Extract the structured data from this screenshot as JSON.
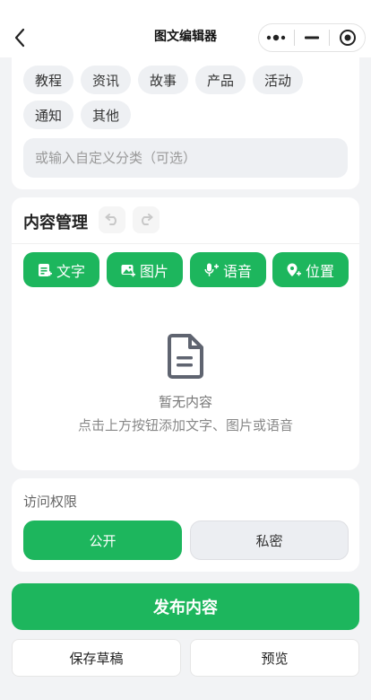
{
  "nav": {
    "title": "图文编辑器",
    "back_icon": "chevron-left-icon",
    "more_icon": "more-dots-icon",
    "minimize_icon": "minimize-icon",
    "close_icon": "target-circle-icon"
  },
  "categories": {
    "chips": [
      "教程",
      "资讯",
      "故事",
      "产品",
      "活动",
      "通知",
      "其他"
    ],
    "custom_placeholder": "或输入自定义分类（可选）"
  },
  "content": {
    "title": "内容管理",
    "undo_icon": "undo-icon",
    "redo_icon": "redo-icon",
    "add_buttons": [
      {
        "label": "文字",
        "icon": "text-doc-icon"
      },
      {
        "label": "图片",
        "icon": "image-add-icon"
      },
      {
        "label": "语音",
        "icon": "mic-icon"
      },
      {
        "label": "位置",
        "icon": "location-pin-icon"
      }
    ],
    "empty_icon": "document-icon",
    "empty_title": "暂无内容",
    "empty_hint": "点击上方按钮添加文字、图片或语音"
  },
  "access": {
    "label": "访问权限",
    "public": "公开",
    "private": "私密",
    "selected": "公开"
  },
  "actions": {
    "publish": "发布内容",
    "save_draft": "保存草稿",
    "preview": "预览"
  },
  "colors": {
    "accent": "#1db65d",
    "chip_bg": "#eef0f3",
    "page_bg": "#f2f3f5"
  }
}
